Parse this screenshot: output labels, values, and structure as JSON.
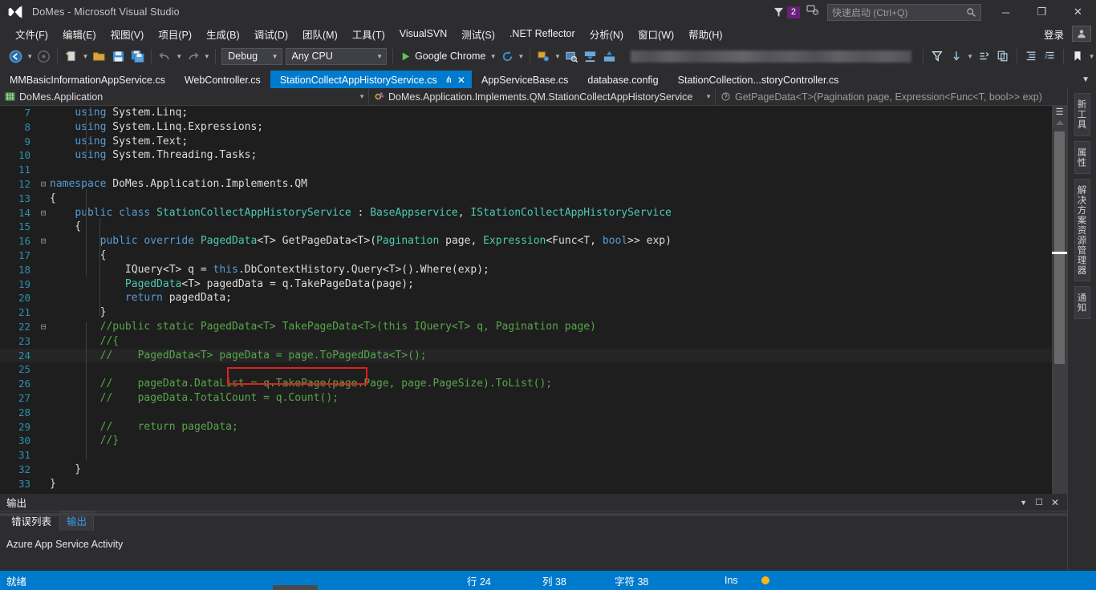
{
  "window": {
    "title": "DoMes - Microsoft Visual Studio",
    "logo_icon": "visual-studio-logo",
    "minimize_label": "─",
    "maximize_label": "❐",
    "close_label": "✕"
  },
  "titlebar": {
    "notification_icon": "flag-icon",
    "notification_count": "2",
    "feedback_icon": "feedback-smiley-icon",
    "quick_launch_placeholder": "快速启动 (Ctrl+Q)",
    "quick_launch_value": "",
    "search_icon": "search-icon"
  },
  "menu": {
    "items": [
      {
        "label": "文件(F)"
      },
      {
        "label": "编辑(E)"
      },
      {
        "label": "视图(V)"
      },
      {
        "label": "项目(P)"
      },
      {
        "label": "生成(B)"
      },
      {
        "label": "调试(D)"
      },
      {
        "label": "团队(M)"
      },
      {
        "label": "工具(T)"
      },
      {
        "label": "VisualSVN"
      },
      {
        "label": "测试(S)"
      },
      {
        "label": ".NET Reflector"
      },
      {
        "label": "分析(N)"
      },
      {
        "label": "窗口(W)"
      },
      {
        "label": "帮助(H)"
      }
    ],
    "sign_in_label": "登录",
    "account_icon": "account-icon"
  },
  "toolbar": {
    "navigate_back_icon": "navigate-back-icon",
    "navigate_forward_icon": "navigate-forward-icon",
    "new_project_icon": "new-project-icon",
    "open_file_icon": "open-file-icon",
    "save_icon": "save-icon",
    "save_all_icon": "save-all-icon",
    "undo_icon": "undo-icon",
    "redo_icon": "redo-icon",
    "configuration": "Debug",
    "platform": "Any CPU",
    "start_label": "Google Chrome",
    "start_icon": "play-icon",
    "refresh_icon": "refresh-icon",
    "attach_icon": "attach-to-process-icon",
    "find_window_icon": "find-window-icon",
    "download_icon": "download-icon",
    "upload_icon": "upload-icon",
    "redacted_field": "",
    "y_icon": "filter-icon",
    "down_arrow_icon": "sort-down-icon",
    "step_icon": "step-into-icon",
    "copy_icon": "copy-icon",
    "indent_icon": "indent-icon",
    "comment_icon": "comment-icon",
    "bookmark_icon": "bookmark-icon"
  },
  "tabs": {
    "items": [
      {
        "label": "MMBasicInformationAppService.cs",
        "active": false
      },
      {
        "label": "WebController.cs",
        "active": false
      },
      {
        "label": "StationCollectAppHistoryService.cs",
        "active": true
      },
      {
        "label": "AppServiceBase.cs",
        "active": false
      },
      {
        "label": "database.config",
        "active": false
      },
      {
        "label": "StationCollection...storyController.cs",
        "active": false
      }
    ],
    "pin_icon": "pin-icon",
    "close_icon": "close-icon",
    "overflow_icon": "tab-overflow-icon"
  },
  "navbar": {
    "project_icon": "project-icon",
    "project": "DoMes.Application",
    "class_icon": "class-icon",
    "class": "DoMes.Application.Implements.QM.StationCollectAppHistoryService",
    "member_icon": "method-icon",
    "member": "GetPageData<T>(Pagination page, Expression<Func<T, bool>> exp)",
    "caret": "▾"
  },
  "editor": {
    "highlight_box": {
      "name": "red-annotation-box",
      "color": "#e02020"
    },
    "lines": [
      {
        "num": "7",
        "fold": "",
        "segments": [
          {
            "t": "    ",
            "c": "pln"
          },
          {
            "t": "using ",
            "c": "kw"
          },
          {
            "t": "System.Linq;",
            "c": "pln"
          }
        ]
      },
      {
        "num": "8",
        "fold": "",
        "segments": [
          {
            "t": "    ",
            "c": "pln"
          },
          {
            "t": "using ",
            "c": "kw"
          },
          {
            "t": "System.Linq.Expressions;",
            "c": "pln"
          }
        ]
      },
      {
        "num": "9",
        "fold": "",
        "segments": [
          {
            "t": "    ",
            "c": "pln"
          },
          {
            "t": "using ",
            "c": "kw"
          },
          {
            "t": "System.Text;",
            "c": "pln"
          }
        ]
      },
      {
        "num": "10",
        "fold": "",
        "segments": [
          {
            "t": "    ",
            "c": "pln"
          },
          {
            "t": "using ",
            "c": "kw"
          },
          {
            "t": "System.Threading.Tasks;",
            "c": "pln"
          }
        ]
      },
      {
        "num": "11",
        "fold": "",
        "segments": []
      },
      {
        "num": "12",
        "fold": "-",
        "segments": [
          {
            "t": "namespace ",
            "c": "kw"
          },
          {
            "t": "DoMes.Application.Implements.QM",
            "c": "pln"
          }
        ]
      },
      {
        "num": "13",
        "fold": "",
        "segments": [
          {
            "t": "{",
            "c": "pln"
          }
        ]
      },
      {
        "num": "14",
        "fold": "-",
        "segments": [
          {
            "t": "    ",
            "c": "pln"
          },
          {
            "t": "public class ",
            "c": "kw"
          },
          {
            "t": "StationCollectAppHistoryService",
            "c": "typ"
          },
          {
            "t": " : ",
            "c": "pln"
          },
          {
            "t": "BaseAppservice",
            "c": "typ"
          },
          {
            "t": ", ",
            "c": "pln"
          },
          {
            "t": "IStationCollectAppHistoryService",
            "c": "typ"
          }
        ]
      },
      {
        "num": "15",
        "fold": "",
        "segments": [
          {
            "t": "    {",
            "c": "pln"
          }
        ]
      },
      {
        "num": "16",
        "fold": "-",
        "segments": [
          {
            "t": "        ",
            "c": "pln"
          },
          {
            "t": "public override ",
            "c": "kw"
          },
          {
            "t": "PagedData",
            "c": "typ"
          },
          {
            "t": "<T> GetPageData<T>(",
            "c": "pln"
          },
          {
            "t": "Pagination",
            "c": "typ"
          },
          {
            "t": " page, ",
            "c": "pln"
          },
          {
            "t": "Expression",
            "c": "typ"
          },
          {
            "t": "<Func<T, ",
            "c": "pln"
          },
          {
            "t": "bool",
            "c": "kw"
          },
          {
            "t": ">> exp)",
            "c": "pln"
          }
        ]
      },
      {
        "num": "17",
        "fold": "",
        "segments": [
          {
            "t": "        {",
            "c": "pln"
          }
        ]
      },
      {
        "num": "18",
        "fold": "",
        "segments": [
          {
            "t": "            IQuery<T> q = ",
            "c": "pln"
          },
          {
            "t": "this",
            "c": "kw"
          },
          {
            "t": ".DbContextHistory.Query<T>().Where(exp);",
            "c": "pln"
          }
        ]
      },
      {
        "num": "19",
        "fold": "",
        "segments": [
          {
            "t": "            ",
            "c": "pln"
          },
          {
            "t": "PagedData",
            "c": "typ"
          },
          {
            "t": "<T> pagedData = q.TakePageData(page);",
            "c": "pln"
          }
        ]
      },
      {
        "num": "20",
        "fold": "",
        "segments": [
          {
            "t": "            ",
            "c": "pln"
          },
          {
            "t": "return ",
            "c": "kw"
          },
          {
            "t": "pagedData;",
            "c": "pln"
          }
        ]
      },
      {
        "num": "21",
        "fold": "",
        "segments": [
          {
            "t": "        }",
            "c": "pln"
          }
        ]
      },
      {
        "num": "22",
        "fold": "-",
        "segments": [
          {
            "t": "        //public static PagedData<T> TakePageData<T>(this IQuery<T> q, Pagination page)",
            "c": "cmt"
          }
        ]
      },
      {
        "num": "23",
        "fold": "",
        "segments": [
          {
            "t": "        //{",
            "c": "cmt"
          }
        ]
      },
      {
        "num": "24",
        "fold": "",
        "hl": true,
        "segments": [
          {
            "t": "        //    PagedData<T> pageData = page.ToPagedData<T>();",
            "c": "cmt"
          }
        ]
      },
      {
        "num": "25",
        "fold": "",
        "segments": []
      },
      {
        "num": "26",
        "fold": "",
        "segments": [
          {
            "t": "        //    pageData.DataList = q.TakePage(page.Page, page.PageSize).ToList();",
            "c": "cmt"
          }
        ]
      },
      {
        "num": "27",
        "fold": "",
        "segments": [
          {
            "t": "        //    pageData.TotalCount = q.Count();",
            "c": "cmt"
          }
        ]
      },
      {
        "num": "28",
        "fold": "",
        "segments": []
      },
      {
        "num": "29",
        "fold": "",
        "segments": [
          {
            "t": "        //    return pageData;",
            "c": "cmt"
          }
        ]
      },
      {
        "num": "30",
        "fold": "",
        "segments": [
          {
            "t": "        //}",
            "c": "cmt"
          }
        ]
      },
      {
        "num": "31",
        "fold": "",
        "segments": []
      },
      {
        "num": "32",
        "fold": "",
        "segments": [
          {
            "t": "    }",
            "c": "pln"
          }
        ]
      },
      {
        "num": "33",
        "fold": "",
        "segments": [
          {
            "t": "}",
            "c": "pln"
          }
        ]
      }
    ],
    "scrollbar": {
      "split_icon": "split-view-icon",
      "up_arrow_icon": "scroll-up-icon"
    }
  },
  "right_dock": {
    "tabs": [
      {
        "label": "新工具"
      },
      {
        "label": "属性"
      },
      {
        "label": "解决方案资源管理器"
      },
      {
        "label": "通知"
      }
    ]
  },
  "output_panel": {
    "title": "输出",
    "dropdown_icon": "chevron-down-icon",
    "maximize_icon": "maximize-panel-icon",
    "close_icon": "close-panel-icon",
    "tabs": [
      {
        "label": "错误列表",
        "active": false
      },
      {
        "label": "输出",
        "active": true
      }
    ],
    "content": "Azure App Service Activity"
  },
  "statusbar": {
    "ready": "就绪",
    "row_label": "行 24",
    "col_label": "列 38",
    "char_label": "字符 38",
    "insert_mode": "Ins",
    "indicator_icon": "status-indicator-icon",
    "accent_color": "#007acc"
  }
}
